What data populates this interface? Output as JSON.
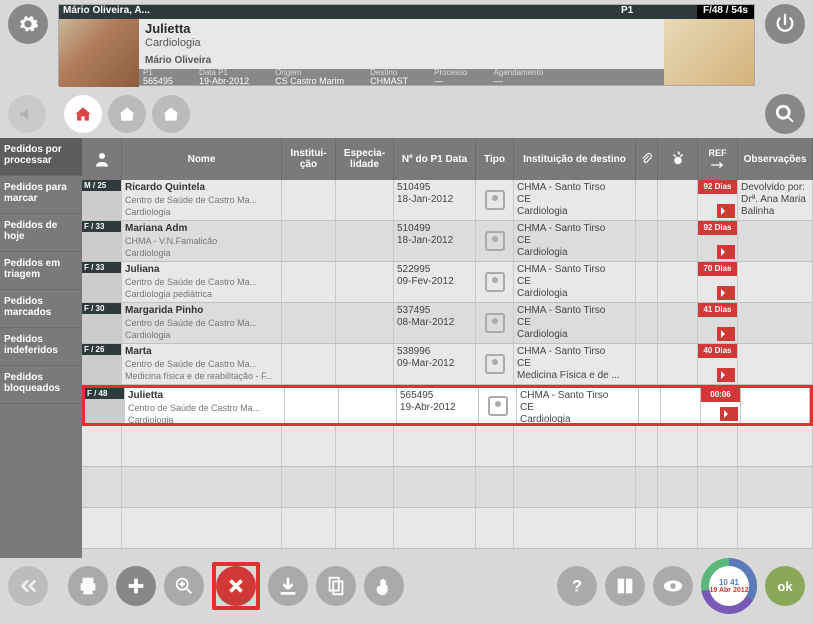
{
  "patient_card": {
    "header_name": "Mário Oliveira, A...",
    "header_demo": "F/48 / 54s",
    "name": "Julietta",
    "specialty": "Cardiologia",
    "doctor": "Mário Oliveira",
    "p1_label": "P1",
    "p1_value": "565495",
    "datap1_label": "Data P1",
    "datap1_value": "19-Abr-2012",
    "origem_label": "Origem",
    "origem_value": "CS Castro Marim",
    "destino_label": "Destino",
    "destino_value": "CHMAST",
    "processo_label": "Processo",
    "processo_value": "—",
    "agend_label": "Agendamento",
    "agend_value": "—",
    "col_p1": "P1"
  },
  "sidebar": {
    "items": [
      "Pedidos por processar",
      "Pedidos para marcar",
      "Pedidos de hoje",
      "Pedidos em triagem",
      "Pedidos marcados",
      "Pedidos indeferidos",
      "Pedidos bloqueados"
    ]
  },
  "columns": {
    "photo": "",
    "nome": "Nome",
    "inst": "Institui-ção",
    "esp": "Especia-lidade",
    "np1": "Nº do P1 Data",
    "tipo": "Tipo",
    "dest": "Instituição de destino",
    "ref": "REF",
    "obs": "Observações"
  },
  "rows": [
    {
      "demo": "M / 25",
      "nome": "Ricardo Quintela",
      "sub1": "Centro de Saúde de Castro Ma...",
      "sub2": "Cardiologia",
      "np1": "510495",
      "np1d": "18-Jan-2012",
      "dest1": "CHMA - Santo Tirso",
      "dest2": "CE",
      "dest3": "Cardiologia",
      "ref": "92 Dias",
      "obs": "Devolvido por: Drª. Ana Maria Balinha"
    },
    {
      "demo": "F / 33",
      "nome": "Mariana Adm",
      "sub1": "CHMA - V.N.Famalicão",
      "sub2": "Cardiologia",
      "np1": "510499",
      "np1d": "18-Jan-2012",
      "dest1": "CHMA - Santo Tirso",
      "dest2": "CE",
      "dest3": "Cardiologia",
      "ref": "92 Dias",
      "obs": ""
    },
    {
      "demo": "F / 33",
      "nome": "Juliana",
      "sub1": "Centro de Saúde de Castro Ma...",
      "sub2": "Cardiologia pediátrica",
      "np1": "522995",
      "np1d": "09-Fev-2012",
      "dest1": "CHMA - Santo Tirso",
      "dest2": "CE",
      "dest3": "Cardiologia",
      "ref": "70 Dias",
      "obs": ""
    },
    {
      "demo": "F / 30",
      "nome": "Margarida Pinho",
      "sub1": "Centro de Saúde de Castro Ma...",
      "sub2": "Cardiologia",
      "np1": "537495",
      "np1d": "08-Mar-2012",
      "dest1": "CHMA - Santo Tirso",
      "dest2": "CE",
      "dest3": "Cardiologia",
      "ref": "41 Dias",
      "obs": ""
    },
    {
      "demo": "F / 26",
      "nome": "Marta",
      "sub1": "Centro de Saúde de Castro Ma...",
      "sub2": "Medicina física e de reabilitação - F...",
      "np1": "538996",
      "np1d": "09-Mar-2012",
      "dest1": "CHMA - Santo Tirso",
      "dest2": "CE",
      "dest3": "Medicina Física e de ...",
      "ref": "40 Dias",
      "obs": ""
    },
    {
      "demo": "F / 48",
      "nome": "Julietta",
      "sub1": "Centro de Saúde de Castro Ma...",
      "sub2": "Cardiologia",
      "np1": "565495",
      "np1d": "19-Abr-2012",
      "dest1": "CHMA - Santo Tirso",
      "dest2": "CE",
      "dest3": "Cardiologia",
      "ref": "00:06",
      "obs": "",
      "selected": true
    }
  ],
  "clock": {
    "time": "10 41",
    "date": "19 Abr 2012"
  },
  "ok": "ok"
}
